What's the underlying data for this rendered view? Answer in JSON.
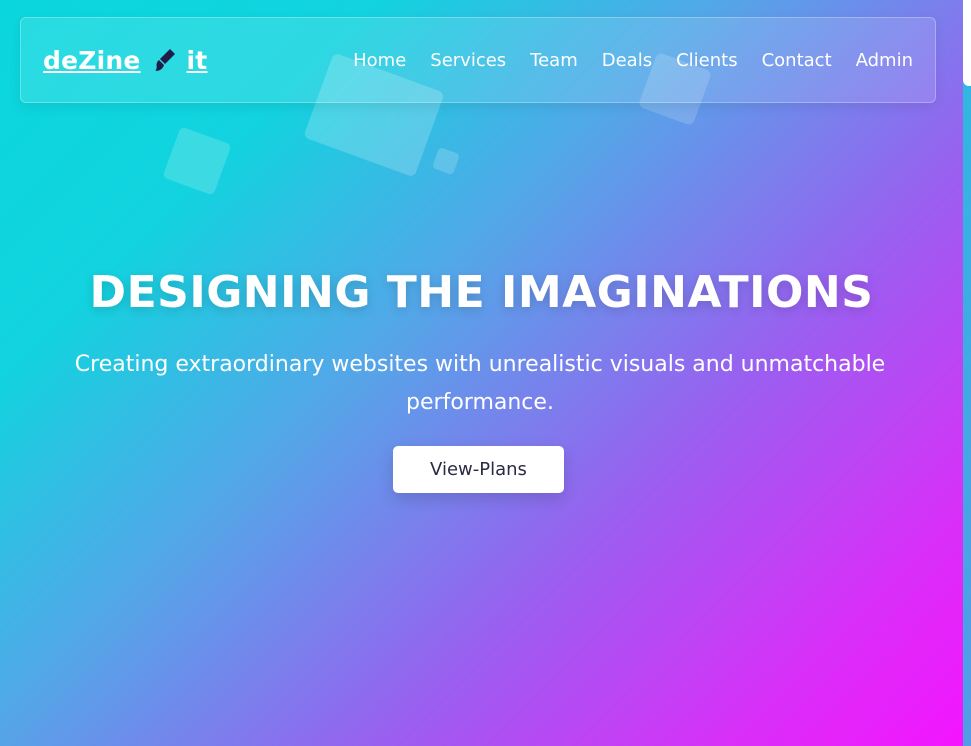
{
  "brand": {
    "name_part1": "deZine",
    "name_part2": "it",
    "icon": "paint-brush-icon"
  },
  "nav": {
    "items": [
      {
        "label": "Home"
      },
      {
        "label": "Services"
      },
      {
        "label": "Team"
      },
      {
        "label": "Deals"
      },
      {
        "label": "Clients"
      },
      {
        "label": "Contact"
      },
      {
        "label": "Admin"
      }
    ]
  },
  "hero": {
    "title": "DESIGNING THE IMAGINATIONS",
    "subtitle": "Creating extraordinary websites with unrealistic visuals and unmatchable performance.",
    "cta_label": "View-Plans"
  },
  "colors": {
    "gradient_start": "#0ad7dd",
    "gradient_mid": "#9b5ef0",
    "gradient_end": "#f513ff",
    "brush_icon": "#1f1d4a",
    "cta_text": "#2a2a44"
  }
}
